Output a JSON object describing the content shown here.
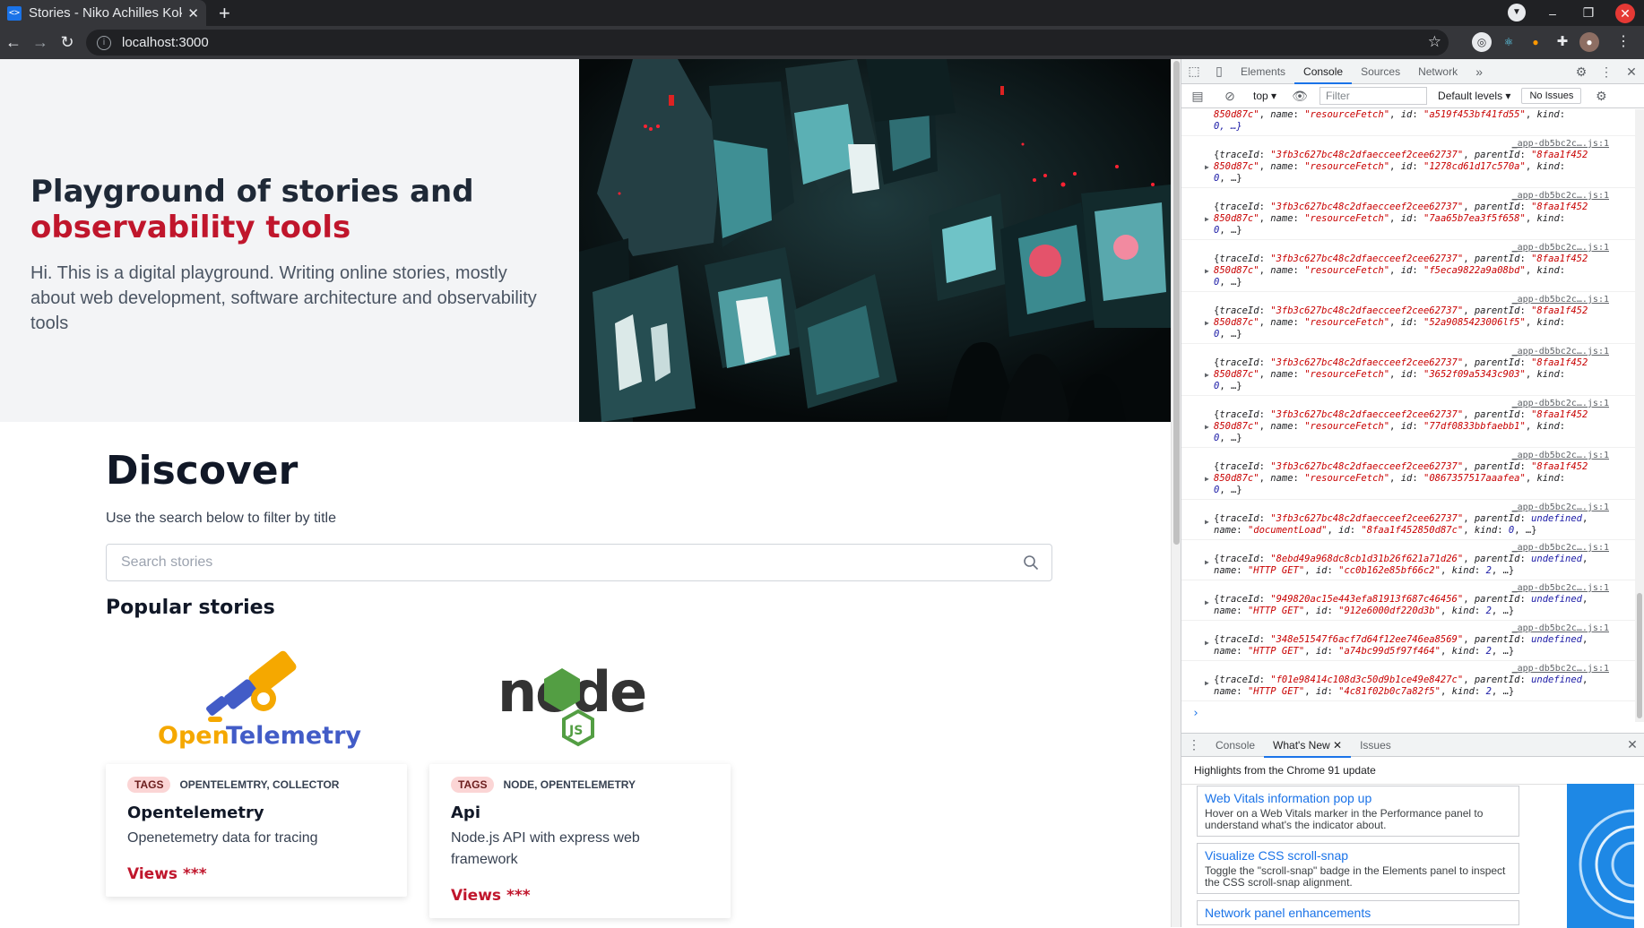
{
  "browser": {
    "tab_title": "Stories - Niko Achilles Kok",
    "tab_favicon": "<>",
    "url": "localhost:3000"
  },
  "hero": {
    "title_line1": "Playground of stories and",
    "title_line2": "observability tools",
    "description": "Hi. This is a digital playground. Writing online stories, mostly about web development, software architecture and observability tools"
  },
  "discover": {
    "heading": "Discover",
    "subtitle": "Use the search below to filter by title",
    "search_placeholder": "Search stories",
    "popular_heading": "Popular stories"
  },
  "stories": [
    {
      "logo_text_1": "Open",
      "logo_text_2": "Telemetry",
      "tags_label": "TAGS",
      "tags": "OPENTELEMTRY, COLLECTOR",
      "title": "Opentelemetry",
      "description": "Openetemetry data for tracing",
      "views": "Views ***"
    },
    {
      "logo_text": "node",
      "tags_label": "TAGS",
      "tags": "NODE, OPENTELEMETRY",
      "title": "Api",
      "description": "Node.js API with express web framework",
      "views": "Views ***"
    }
  ],
  "devtools": {
    "tabs": [
      "Elements",
      "Console",
      "Sources",
      "Network"
    ],
    "context": "top",
    "filter_placeholder": "Filter",
    "levels": "Default levels",
    "issues": "No Issues",
    "source_link": "_app-db5bc2c….js:1",
    "first_partial": {
      "line1_a": "850d87c\"",
      "line1_name": "resourceFetch",
      "line1_id": "a519f453bf41fd55",
      "line2": "0, …}"
    },
    "logs": [
      {
        "traceId": "3fb3c627bc48c2dfaecceef2cee62737",
        "parentId": "8faa1f452",
        "parent2": "850d87c",
        "name": "resourceFetch",
        "id": "1278cd61d17c570a",
        "kind": "0"
      },
      {
        "traceId": "3fb3c627bc48c2dfaecceef2cee62737",
        "parentId": "8faa1f452",
        "parent2": "850d87c",
        "name": "resourceFetch",
        "id": "7aa65b7ea3f5f658",
        "kind": "0"
      },
      {
        "traceId": "3fb3c627bc48c2dfaecceef2cee62737",
        "parentId": "8faa1f452",
        "parent2": "850d87c",
        "name": "resourceFetch",
        "id": "f5eca9822a9a08bd",
        "kind": "0"
      },
      {
        "traceId": "3fb3c627bc48c2dfaecceef2cee62737",
        "parentId": "8faa1f452",
        "parent2": "850d87c",
        "name": "resourceFetch",
        "id": "52a9085423006lf5",
        "kind": "0"
      },
      {
        "traceId": "3fb3c627bc48c2dfaecceef2cee62737",
        "parentId": "8faa1f452",
        "parent2": "850d87c",
        "name": "resourceFetch",
        "id": "3652f09a5343c903",
        "kind": "0"
      },
      {
        "traceId": "3fb3c627bc48c2dfaecceef2cee62737",
        "parentId": "8faa1f452",
        "parent2": "850d87c",
        "name": "resourceFetch",
        "id": "77df0833bbfaebb1",
        "kind": "0"
      },
      {
        "traceId": "3fb3c627bc48c2dfaecceef2cee62737",
        "parentId": "8faa1f452",
        "parent2": "850d87c",
        "name": "resourceFetch",
        "id": "0867357517aaafea",
        "kind": "0"
      }
    ],
    "short_logs": [
      {
        "traceId": "3fb3c627bc48c2dfaecceef2cee62737",
        "name": "documentLoad",
        "id": "8faa1f452850d87c",
        "kind": "0"
      },
      {
        "traceId": "8ebd49a968dc8cb1d31b26f621a71d26",
        "name": "HTTP GET",
        "id": "cc0b162e85bf66c2",
        "kind": "2"
      },
      {
        "traceId": "949820ac15e443efa81913f687c46456",
        "name": "HTTP GET",
        "id": "912e6000df220d3b",
        "kind": "2"
      },
      {
        "traceId": "348e51547f6acf7d64f12ee746ea8569",
        "name": "HTTP GET",
        "id": "a74bc99d5f97f464",
        "kind": "2"
      },
      {
        "traceId": "f01e98414c108d3c50d9b1ce49e8427c",
        "name": "HTTP GET",
        "id": "4c81f02b0c7a82f5",
        "kind": "2"
      }
    ],
    "drawer_tabs": [
      "Console",
      "What's New",
      "Issues"
    ],
    "drawer_heading": "Highlights from the Chrome 91 update",
    "news": [
      {
        "title": "Web Vitals information pop up",
        "desc": "Hover on a Web Vitals marker in the Performance panel to understand what's the indicator about."
      },
      {
        "title": "Visualize CSS scroll-snap",
        "desc": "Toggle the \"scroll-snap\" badge in the Elements panel to inspect the CSS scroll-snap alignment."
      },
      {
        "title": "Network panel enhancements",
        "desc": ""
      }
    ]
  },
  "colors": {
    "accent": "#c0162c",
    "devtools_link": "#1a73e8",
    "chrome_dark": "#202124"
  }
}
